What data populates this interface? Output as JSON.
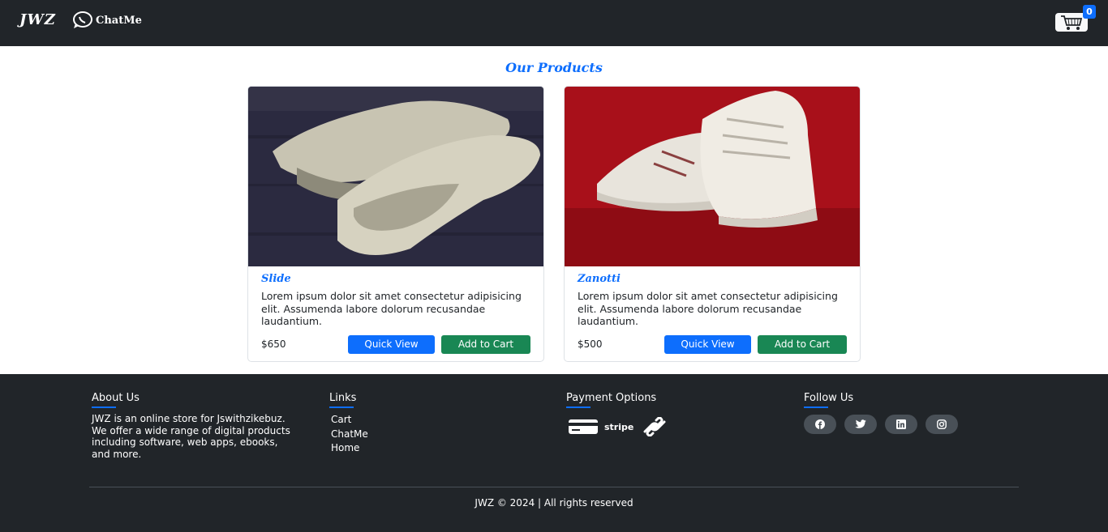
{
  "header": {
    "brand": "JWZ",
    "chatme_label": "ChatMe",
    "cart_count": "0"
  },
  "main": {
    "title": "Our Products",
    "products": [
      {
        "name": "Slide",
        "description": "Lorem ipsum dolor sit amet consectetur adipisicing elit. Assumenda labore dolorum recusandae laudantium.",
        "price": "$650",
        "quick_view_label": "Quick View",
        "add_to_cart_label": "Add to Cart"
      },
      {
        "name": "Zanotti",
        "description": "Lorem ipsum dolor sit amet consectetur adipisicing elit. Assumenda labore dolorum recusandae laudantium.",
        "price": "$500",
        "quick_view_label": "Quick View",
        "add_to_cart_label": "Add to Cart"
      }
    ]
  },
  "footer": {
    "about": {
      "heading": "About Us",
      "text": "JWZ is an online store for Jswithzikebuz. We offer a wide range of digital products including software, web apps, ebooks, and more."
    },
    "links": {
      "heading": "Links",
      "items": [
        "Cart",
        "ChatMe",
        "Home"
      ]
    },
    "payment": {
      "heading": "Payment Options",
      "stripe_label": "stripe"
    },
    "follow": {
      "heading": "Follow Us",
      "icons": [
        "facebook-icon",
        "twitter-icon",
        "linkedin-icon",
        "instagram-icon"
      ]
    },
    "copyright": "JWZ © 2024 | All rights reserved"
  },
  "colors": {
    "dark": "#212529",
    "primary": "#0d6efd",
    "success": "#198754"
  }
}
